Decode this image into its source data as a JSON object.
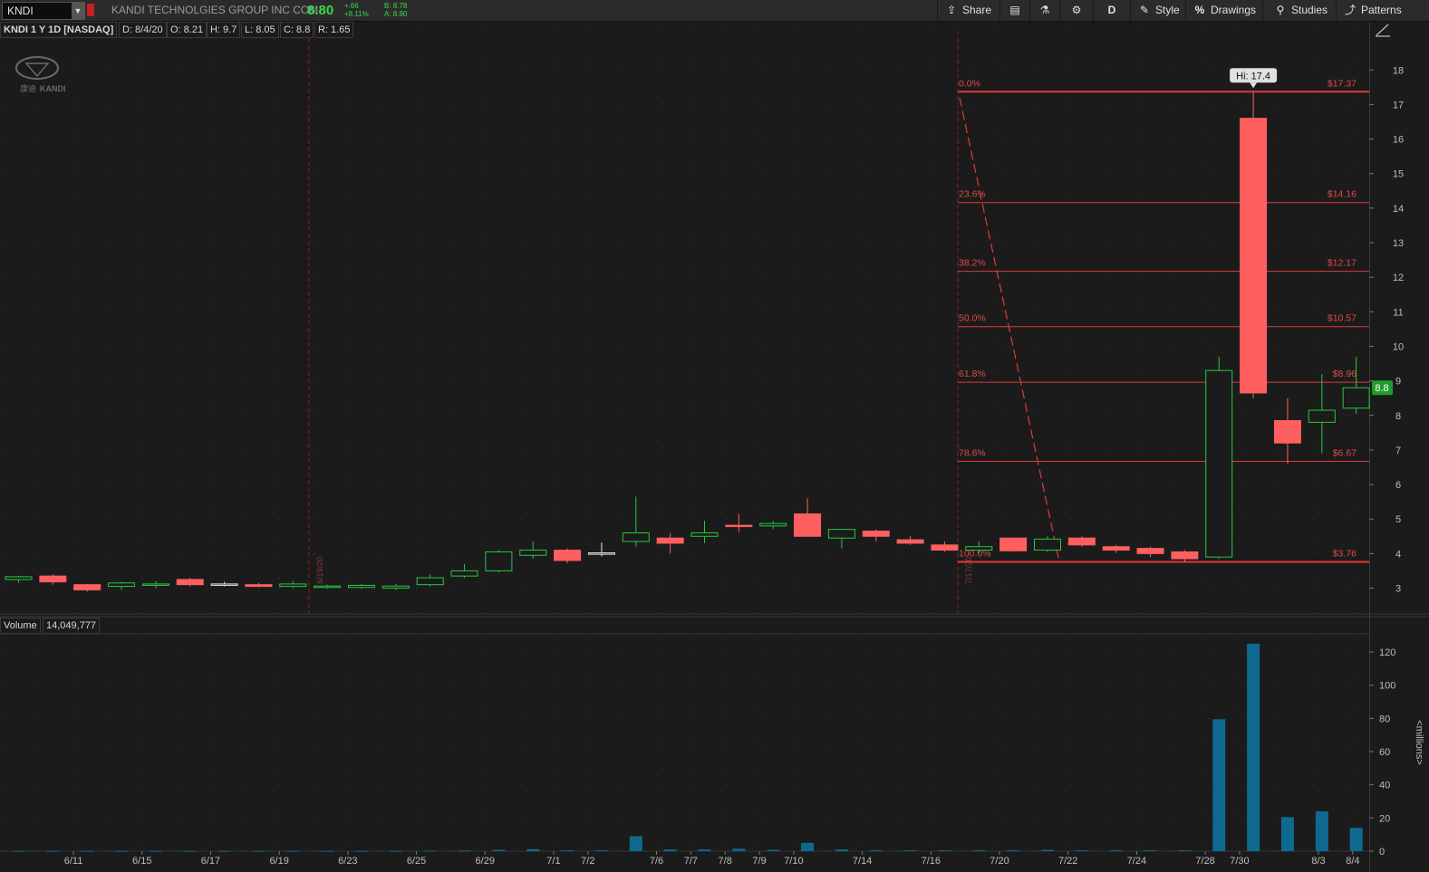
{
  "toolbar": {
    "symbol": "KNDI",
    "company": "KANDI TECHNOLGIES GROUP INC COM",
    "last": "8.80",
    "change": "+.66",
    "change_pct": "+8.11%",
    "bid": "B: 8.78",
    "ask": "A: 8.80",
    "share": "Share",
    "period": "D",
    "style": "Style",
    "drawings": "Drawings",
    "studies": "Studies",
    "patterns": "Patterns"
  },
  "info": {
    "title": "KNDI 1 Y 1D [NASDAQ]",
    "date": "D: 8/4/20",
    "open": "O: 8.21",
    "high": "H: 9.7",
    "low": "L: 8.05",
    "close": "C: 8.8",
    "range": "R: 1.65"
  },
  "volume_panel": {
    "label": "Volume",
    "value": "14,049,777",
    "unit": "<millions>"
  },
  "logo": {
    "text": "KANDI",
    "chinese": "康迪"
  },
  "colors": {
    "up": "#27c93f",
    "down": "#ff5f5f",
    "volume": "#0f6a8f",
    "fib": "#e03a3a",
    "price_tag": "#1f9e2f"
  },
  "chart_data": {
    "type": "candlestick",
    "x_ticks": [
      "6/11",
      "6/15",
      "6/17",
      "6/19",
      "6/23",
      "6/25",
      "6/29",
      "7/1",
      "7/2",
      "7/6",
      "7/7",
      "7/8",
      "7/9",
      "7/10",
      "7/14",
      "7/16",
      "7/20",
      "7/22",
      "7/24",
      "7/28",
      "7/30",
      "8/3",
      "8/4"
    ],
    "y_ticks": [
      3,
      4,
      5,
      6,
      7,
      8,
      9,
      10,
      11,
      12,
      13,
      14,
      15,
      16,
      17,
      18
    ],
    "volume_ticks": [
      0,
      20,
      40,
      60,
      80,
      100,
      120
    ],
    "candles": [
      {
        "o": 3.25,
        "h": 3.35,
        "l": 3.15,
        "c": 3.33,
        "v": 0.2
      },
      {
        "o": 3.35,
        "h": 3.4,
        "l": 3.1,
        "c": 3.18,
        "v": 0.2
      },
      {
        "o": 3.1,
        "h": 3.12,
        "l": 2.9,
        "c": 2.95,
        "v": 0.2
      },
      {
        "o": 3.05,
        "h": 3.18,
        "l": 2.95,
        "c": 3.15,
        "v": 0.2
      },
      {
        "o": 3.08,
        "h": 3.2,
        "l": 3.0,
        "c": 3.12,
        "v": 0.2
      },
      {
        "o": 3.25,
        "h": 3.3,
        "l": 3.05,
        "c": 3.1,
        "v": 0.2
      },
      {
        "o": 3.12,
        "h": 3.18,
        "l": 3.05,
        "c": 3.12,
        "v": 0.2
      },
      {
        "o": 3.1,
        "h": 3.15,
        "l": 3.02,
        "c": 3.05,
        "v": 0.2
      },
      {
        "o": 3.05,
        "h": 3.2,
        "l": 3.0,
        "c": 3.12,
        "v": 0.2
      },
      {
        "o": 3.02,
        "h": 3.1,
        "l": 2.98,
        "c": 3.06,
        "v": 0.2
      },
      {
        "o": 3.02,
        "h": 3.12,
        "l": 2.98,
        "c": 3.08,
        "v": 0.2
      },
      {
        "o": 3.0,
        "h": 3.12,
        "l": 2.95,
        "c": 3.06,
        "v": 0.2
      },
      {
        "o": 3.1,
        "h": 3.4,
        "l": 3.05,
        "c": 3.3,
        "v": 0.3
      },
      {
        "o": 3.35,
        "h": 3.7,
        "l": 3.3,
        "c": 3.5,
        "v": 0.4
      },
      {
        "o": 3.5,
        "h": 4.1,
        "l": 3.45,
        "c": 4.05,
        "v": 0.8
      },
      {
        "o": 3.95,
        "h": 4.35,
        "l": 3.85,
        "c": 4.1,
        "v": 1.2
      },
      {
        "o": 4.1,
        "h": 4.15,
        "l": 3.72,
        "c": 3.8,
        "v": 0.5
      },
      {
        "o": 3.98,
        "h": 4.32,
        "l": 3.92,
        "c": 4.02,
        "v": 0.5
      },
      {
        "o": 4.35,
        "h": 5.65,
        "l": 4.2,
        "c": 4.6,
        "v": 9.0
      },
      {
        "o": 4.45,
        "h": 4.6,
        "l": 4.0,
        "c": 4.3,
        "v": 1.0
      },
      {
        "o": 4.5,
        "h": 4.95,
        "l": 4.3,
        "c": 4.6,
        "v": 1.0
      },
      {
        "o": 4.82,
        "h": 5.15,
        "l": 4.62,
        "c": 4.78,
        "v": 1.5
      },
      {
        "o": 4.8,
        "h": 4.95,
        "l": 4.72,
        "c": 4.87,
        "v": 0.8
      },
      {
        "o": 5.15,
        "h": 5.6,
        "l": 4.5,
        "c": 4.5,
        "v": 5.0
      },
      {
        "o": 4.45,
        "h": 4.7,
        "l": 4.15,
        "c": 4.7,
        "v": 1.0
      },
      {
        "o": 4.65,
        "h": 4.7,
        "l": 4.35,
        "c": 4.5,
        "v": 0.5
      },
      {
        "o": 4.4,
        "h": 4.5,
        "l": 4.25,
        "c": 4.3,
        "v": 0.5
      },
      {
        "o": 4.25,
        "h": 4.35,
        "l": 4.05,
        "c": 4.1,
        "v": 0.5
      },
      {
        "o": 4.1,
        "h": 4.35,
        "l": 4.0,
        "c": 4.2,
        "v": 0.5
      },
      {
        "o": 4.45,
        "h": 4.45,
        "l": 4.05,
        "c": 4.08,
        "v": 0.5
      },
      {
        "o": 4.1,
        "h": 4.5,
        "l": 4.05,
        "c": 4.42,
        "v": 0.8
      },
      {
        "o": 4.45,
        "h": 4.5,
        "l": 4.2,
        "c": 4.25,
        "v": 0.5
      },
      {
        "o": 4.2,
        "h": 4.25,
        "l": 4.02,
        "c": 4.1,
        "v": 0.5
      },
      {
        "o": 4.15,
        "h": 4.2,
        "l": 3.9,
        "c": 4.0,
        "v": 0.5
      },
      {
        "o": 4.05,
        "h": 4.1,
        "l": 3.76,
        "c": 3.85,
        "v": 0.5
      },
      {
        "o": 3.9,
        "h": 9.7,
        "l": 3.85,
        "c": 9.3,
        "v": 79.5
      },
      {
        "o": 16.6,
        "h": 17.37,
        "l": 8.5,
        "c": 8.65,
        "v": 125.0
      },
      {
        "o": 7.85,
        "h": 8.5,
        "l": 6.6,
        "c": 7.2,
        "v": 20.5
      },
      {
        "o": 7.8,
        "h": 9.2,
        "l": 6.9,
        "c": 8.15,
        "v": 24.0
      },
      {
        "o": 8.21,
        "h": 9.7,
        "l": 8.05,
        "c": 8.8,
        "v": 14.05
      }
    ],
    "annotations": {
      "high_label": "Hi: 17.4",
      "price_tag": "8.8",
      "vline1_label": "6/19/20",
      "vline2_label": "7/17/20"
    },
    "fib_levels": [
      {
        "pct": "0.0%",
        "price": 17.37,
        "label": "$17.37"
      },
      {
        "pct": "23.6%",
        "price": 14.16,
        "label": "$14.16"
      },
      {
        "pct": "38.2%",
        "price": 12.17,
        "label": "$12.17"
      },
      {
        "pct": "50.0%",
        "price": 10.57,
        "label": "$10.57"
      },
      {
        "pct": "61.8%",
        "price": 8.96,
        "label": "$8.96"
      },
      {
        "pct": "78.6%",
        "price": 6.67,
        "label": "$6.67"
      },
      {
        "pct": "100.0%",
        "price": 3.76,
        "label": "$3.76"
      }
    ]
  }
}
